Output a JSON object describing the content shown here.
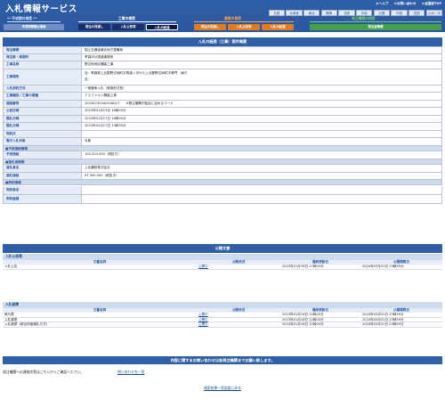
{
  "app": {
    "title": "入札情報サービス",
    "links": [
      "＊ヘルプ",
      "＊お問い合わせ",
      "＊全国版TOP"
    ],
    "regions": [
      "全国",
      "北海道",
      "東北",
      "関東",
      "北陸",
      "中部",
      "近畿",
      "中国",
      "四国",
      "九州・沖縄"
    ]
  },
  "nav": {
    "categories": {
      "announcement": "工事の検索",
      "consulting": "業務の検索",
      "orderer": "発注機関の検索",
      "prev_period": "** 平成期の検索 **"
    },
    "tabs": {
      "heisei": "平成期情報は検索",
      "koji_mitoshi": "発注の見通し",
      "koji_koukoku": "入札公告等",
      "koji_keika": "入札の経過",
      "gyomu_mitoshi": "発注の見通し",
      "gyomu_koukoku": "入札公告等",
      "gyomu_keika": "入札の経過",
      "hacchu_joho": "発注者情報"
    }
  },
  "detail": {
    "heading": "入札の経過（工事）案件概要",
    "rows": [
      {
        "label": "発注機関",
        "value": "国土交通省東北地方整備局"
      },
      {
        "label": "発注部・事務所",
        "value": "青森河川国道事務所"
      },
      {
        "label": "工事名称",
        "value": "野辺地地区舗装工事"
      },
      {
        "label": "工事場所",
        "value": "自：青森県上北郡野辺地町字馬渡ノ沢から上北郡野辺地町字鳴門　地内",
        "value2": "至："
      },
      {
        "label": "入札契約方式",
        "value": "一般競争入札（実施形式型）"
      },
      {
        "label": "工事種別／工事の業種",
        "value": "アスファルト舗装工事"
      },
      {
        "label": "調達番号",
        "value": "2022R2302A0018027　　※発注機関が独自に定めるコード"
      },
      {
        "label": "公告日時",
        "value": "2023年01月23日 16時00分"
      },
      {
        "label": "開札日時",
        "value": "2023年01月27日 16時00分"
      },
      {
        "label": "開札日時",
        "value": "2023年02月27日 13時30分"
      },
      {
        "label": "契約日",
        "value": ""
      },
      {
        "label": "電子入札対象",
        "value": "対象"
      }
    ],
    "section_budget": "■予定価格情報",
    "budget_rows": [
      {
        "label": "予定価格",
        "value": "100,320,000（税抜き）"
      }
    ],
    "section_award": "■落札者情報",
    "award_rows": [
      {
        "label": "落札者名",
        "value": "上北舗設株式会社"
      },
      {
        "label": "落札価格",
        "value": "97,300,000（税抜き）"
      }
    ],
    "section_contract": "■契約情報",
    "contract_rows": [
      {
        "label": "契約者名",
        "value": ""
      },
      {
        "label": "契約金額",
        "value": ""
      }
    ]
  },
  "docs": {
    "heading": "公開文書",
    "columns": [
      "文書名称",
      "公開状況",
      "最終更新日",
      "公開期限日"
    ],
    "group1_title": "入札公告等",
    "group1_rows": [
      {
        "name": "入札公告",
        "status": "公開中",
        "updated": "2023年01月18日 17時00分",
        "deadline": "2024年03月31日 23時59分"
      }
    ],
    "group2_title": "入札結果",
    "group2_rows": [
      {
        "name": "執行書",
        "status": "公開中",
        "updated": "2023年01月18日 12時00分",
        "deadline": "2024年03月31日 23時59分"
      },
      {
        "name": "入札調書",
        "status": "公開中",
        "updated": "2023年01月18日 12時00分",
        "deadline": "2024年03月31日 23時59分"
      },
      {
        "name": "入札調書（総合評価落札方式）",
        "status": "公開中",
        "updated": "2023年01月18日 12時00分",
        "deadline": "2024年03月31日 23時59分"
      }
    ]
  },
  "contact": {
    "banner": "内容に関するお問い合わせは各発注機関までお願い致します。",
    "text": "発注機関への連絡先等はこちらからご確認ください。",
    "link": "問い合わせ先一覧",
    "back_link": "検索結果一覧画面に戻る"
  },
  "colors": {
    "primary": "#2f5fa6",
    "koji": "#1b2f6b",
    "gyomu": "#e07b1e",
    "hacchu": "#46a049"
  }
}
